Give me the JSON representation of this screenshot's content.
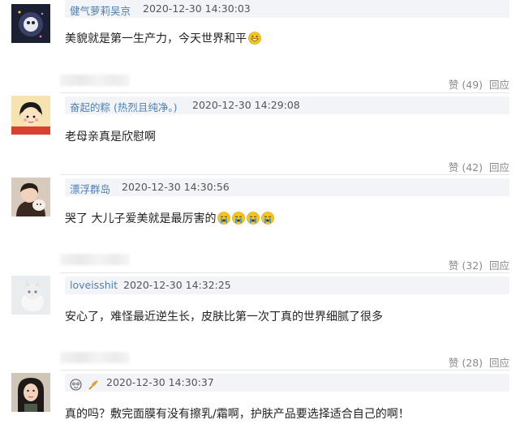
{
  "comments": [
    {
      "username": "健气萝莉吴京",
      "time": "2020-12-30 14:30:03",
      "content": "美貌就是第一生产力，今天世界和平",
      "emoji": "grinning-emoji"
    },
    {
      "username": "奋起的粽 (热烈且纯净。)",
      "time": "2020-12-30 14:29:08",
      "content": "老母亲真是欣慰啊",
      "like_label": "赞",
      "like_count": "(49)",
      "reply_label": "回应"
    },
    {
      "username": "漂浮群岛",
      "time": "2020-12-30 14:30:56",
      "content": "哭了 大儿子爱美就是最厉害的",
      "emoji": "crying-emoji",
      "like_label": "赞",
      "like_count": "(42)",
      "reply_label": "回应"
    },
    {
      "username": "loveisshit",
      "time": "2020-12-30 14:32:25",
      "content": "安心了，难怪最近逆生长，皮肤比第一次丁真的世界细腻了很多",
      "like_label": "赞",
      "like_count": "(32)",
      "reply_label": "回应"
    },
    {
      "username": "",
      "time": "2020-12-30 14:30:37",
      "content": "真的吗？敷完面膜有没有擦乳/霜啊，护肤产品要选择适合自己的啊！",
      "username_icons": [
        "face-icon",
        "feather-icon"
      ],
      "like_label": "赞",
      "like_count": "(28)",
      "reply_label": "回应"
    }
  ]
}
